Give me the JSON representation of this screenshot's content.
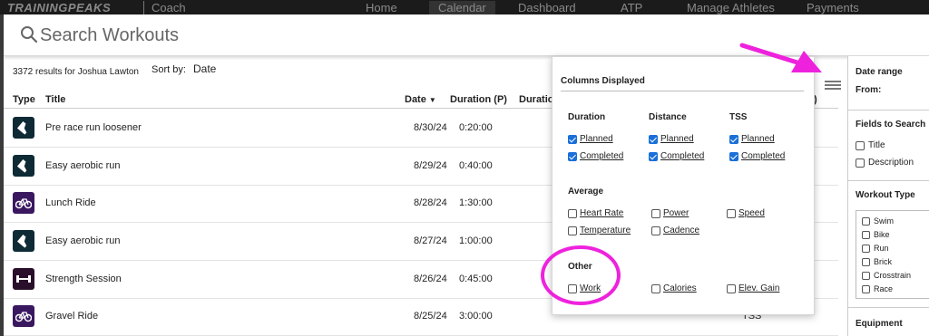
{
  "nav": {
    "logo": "TRAININGPEAKS",
    "section": "Coach",
    "items": [
      "Home",
      "Calendar",
      "Dashboard",
      "ATP",
      "Manage Athletes",
      "Payments"
    ]
  },
  "search": {
    "placeholder": "Search Workouts"
  },
  "results": {
    "count_text": "3372 results for Joshua Lawton",
    "sort_label": "Sort by:",
    "sort_value": "Date"
  },
  "table": {
    "headers": {
      "type": "Type",
      "title": "Title",
      "date": "Date",
      "duration_p": "Duration (P)",
      "duration_c": "Duratio",
      "extra": "C)"
    },
    "rows": [
      {
        "icon": "run-shoe-icon",
        "title": "Pre race run loosener",
        "date": "8/30/24",
        "duration": "0:20:00",
        "extra": ""
      },
      {
        "icon": "run-shoe-icon",
        "title": "Easy aerobic run",
        "date": "8/29/24",
        "duration": "0:40:00",
        "extra": ""
      },
      {
        "icon": "bike-icon",
        "title": "Lunch Ride",
        "date": "8/28/24",
        "duration": "1:30:00",
        "extra": ""
      },
      {
        "icon": "run-shoe-icon",
        "title": "Easy aerobic run",
        "date": "8/27/24",
        "duration": "1:00:00",
        "extra": ""
      },
      {
        "icon": "dumbbell-icon",
        "title": "Strength Session",
        "date": "8/26/24",
        "duration": "0:45:00",
        "extra": ""
      },
      {
        "icon": "bike-icon",
        "title": "Gravel Ride",
        "date": "8/25/24",
        "duration": "3:00:00",
        "extra": "TSS"
      }
    ]
  },
  "columns_menu": {
    "title": "Columns Displayed",
    "headings": {
      "duration": "Duration",
      "distance": "Distance",
      "tss": "TSS",
      "average": "Average",
      "other": "Other"
    },
    "options": {
      "duration_planned": {
        "label": "Planned",
        "checked": true
      },
      "duration_completed": {
        "label": "Completed",
        "checked": true
      },
      "distance_planned": {
        "label": "Planned",
        "checked": true
      },
      "distance_completed": {
        "label": "Completed",
        "checked": true
      },
      "tss_planned": {
        "label": "Planned",
        "checked": true
      },
      "tss_completed": {
        "label": "Completed",
        "checked": true
      },
      "heart_rate": {
        "label": "Heart Rate",
        "checked": false
      },
      "power": {
        "label": "Power",
        "checked": false
      },
      "speed": {
        "label": "Speed",
        "checked": false
      },
      "temperature": {
        "label": "Temperature",
        "checked": false
      },
      "cadence": {
        "label": "Cadence",
        "checked": false
      },
      "work": {
        "label": "Work",
        "checked": false
      },
      "calories": {
        "label": "Calories",
        "checked": false
      },
      "elev_gain": {
        "label": "Elev. Gain",
        "checked": false
      }
    }
  },
  "sidebar": {
    "date_range": "Date range",
    "from": "From:",
    "fields_heading": "Fields to Search",
    "fields": [
      "Title",
      "Description"
    ],
    "workout_type_heading": "Workout Type",
    "workout_types": [
      "Swim",
      "Bike",
      "Run",
      "Brick",
      "Crosstrain",
      "Race"
    ],
    "equipment_heading": "Equipment"
  },
  "colors": {
    "annotation": "#ee22dd",
    "checkbox": "#1a6fd8",
    "run_icon_bg": "#0d2a35",
    "bike_icon_bg": "#3a1860"
  }
}
